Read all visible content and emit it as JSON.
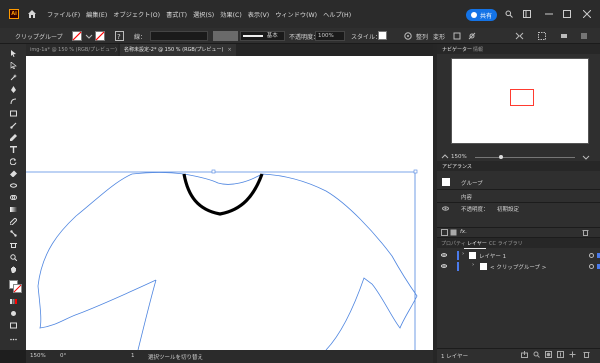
{
  "app": {
    "logo_text": "Ai"
  },
  "menu": [
    "ファイル(F)",
    "編集(E)",
    "オブジェクト(O)",
    "書式(T)",
    "選択(S)",
    "効果(C)",
    "表示(V)",
    "ウィンドウ(W)",
    "ヘルプ(H)"
  ],
  "header": {
    "share_label": "共有"
  },
  "control_bar": {
    "selection_label": "クリップグループ",
    "stroke_label": "線：",
    "stroke_style": "基本",
    "opacity_label": "不透明度：",
    "opacity_value": "100%",
    "style_label": "スタイル：",
    "align_label": "整列",
    "transform_label": "変形",
    "stroke_color": "#ff0000"
  },
  "tabs": [
    {
      "label": "img-1a* @ 150 % (RGB/プレビュー)",
      "active": false
    },
    {
      "label": "名称未設定-2* @ 150 % (RGB/プレビュー)",
      "active": true
    }
  ],
  "status_bar": {
    "zoom": "150%",
    "rotation": "0°",
    "page": "1",
    "tool_status": "選択ツールを切り替え"
  },
  "navigator": {
    "tabs": [
      {
        "label": "ナビゲーター",
        "active": true
      },
      {
        "label": "情報",
        "active": false
      }
    ],
    "zoom": "150%"
  },
  "appearance": {
    "title": "アピアランス",
    "object": "グループ",
    "contents": "内容",
    "opacity_label": "不透明度：",
    "opacity_value": "初期設定",
    "fx": "fx."
  },
  "layers": {
    "tabs": [
      {
        "label": "プロパティ",
        "active": false
      },
      {
        "label": "レイヤー",
        "active": true
      },
      {
        "label": "CC ライブラリ",
        "active": false
      }
    ],
    "items": [
      {
        "label": "レイヤー 1",
        "level": 0
      },
      {
        "label": "< クリップグループ >",
        "level": 1
      }
    ],
    "footer": "1 レイヤー"
  },
  "colors": {
    "accent": "#1473e6",
    "selection": "#4b7bec",
    "nav_frame": "#ff3b30"
  }
}
